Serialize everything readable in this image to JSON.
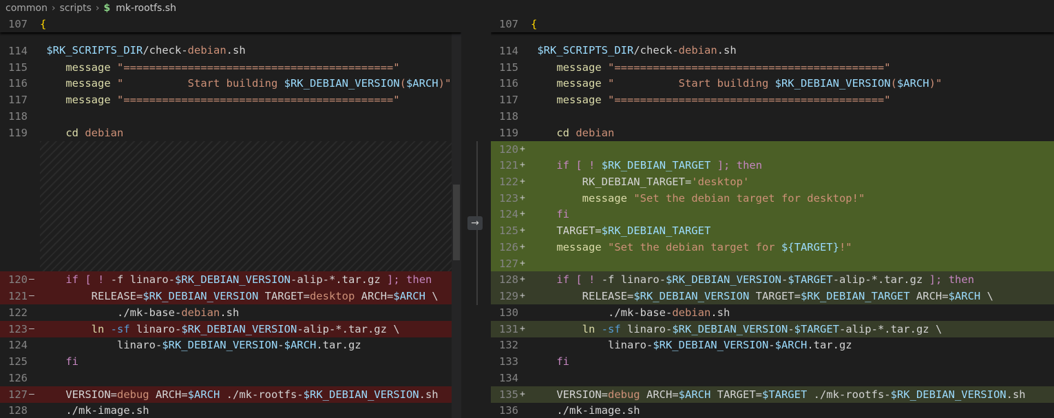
{
  "breadcrumb": {
    "parts": [
      "common",
      "scripts"
    ],
    "dollar": "$",
    "file": "mk-rootfs.sh"
  },
  "left": {
    "sticky_num": "107",
    "sticky_code": "{",
    "partial_code": " $RK_SCRIPTS_DIR/check-debian.sh",
    "lines": [
      {
        "num": "114",
        "mark": "",
        "code": ""
      },
      {
        "num": "115",
        "mark": "",
        "code": "    message \"==========================================\""
      },
      {
        "num": "116",
        "mark": "",
        "code": "    message \"          Start building $RK_DEBIAN_VERSION($ARCH)\""
      },
      {
        "num": "117",
        "mark": "",
        "code": "    message \"==========================================\""
      },
      {
        "num": "118",
        "mark": "",
        "code": ""
      },
      {
        "num": "119",
        "mark": "",
        "code": "    cd debian"
      },
      {
        "num": "120",
        "mark": "—",
        "code": "    if [ ! -f linaro-$RK_DEBIAN_VERSION-alip-*.tar.gz ]; then"
      },
      {
        "num": "121",
        "mark": "—",
        "code": "        RELEASE=$RK_DEBIAN_VERSION TARGET=desktop ARCH=$ARCH \\"
      },
      {
        "num": "122",
        "mark": "",
        "code": "            ./mk-base-debian.sh"
      },
      {
        "num": "123",
        "mark": "—",
        "code": "        ln -sf linaro-$RK_DEBIAN_VERSION-alip-*.tar.gz \\"
      },
      {
        "num": "124",
        "mark": "",
        "code": "            linaro-$RK_DEBIAN_VERSION-$ARCH.tar.gz"
      },
      {
        "num": "125",
        "mark": "",
        "code": "    fi"
      },
      {
        "num": "126",
        "mark": "",
        "code": ""
      },
      {
        "num": "127",
        "mark": "—",
        "code": "    VERSION=debug ARCH=$ARCH ./mk-rootfs-$RK_DEBIAN_VERSION.sh"
      },
      {
        "num": "128",
        "mark": "",
        "code": "    ./mk-image.sh"
      }
    ]
  },
  "right": {
    "sticky_num": "107",
    "sticky_code": "{",
    "partial_code": " $RK_SCRIPTS_DIR/check-debian.sh",
    "lines": [
      {
        "num": "114",
        "mark": "",
        "code": ""
      },
      {
        "num": "115",
        "mark": "",
        "code": "    message \"==========================================\""
      },
      {
        "num": "116",
        "mark": "",
        "code": "    message \"          Start building $RK_DEBIAN_VERSION($ARCH)\""
      },
      {
        "num": "117",
        "mark": "",
        "code": "    message \"==========================================\""
      },
      {
        "num": "118",
        "mark": "",
        "code": ""
      },
      {
        "num": "119",
        "mark": "",
        "code": "    cd debian"
      },
      {
        "num": "120",
        "mark": "+",
        "code": ""
      },
      {
        "num": "121",
        "mark": "+",
        "code": "    if [ ! $RK_DEBIAN_TARGET ]; then"
      },
      {
        "num": "122",
        "mark": "+",
        "code": "        RK_DEBIAN_TARGET='desktop'"
      },
      {
        "num": "123",
        "mark": "+",
        "code": "        message \"Set the debian target for desktop!\""
      },
      {
        "num": "124",
        "mark": "+",
        "code": "    fi"
      },
      {
        "num": "125",
        "mark": "+",
        "code": "    TARGET=$RK_DEBIAN_TARGET"
      },
      {
        "num": "126",
        "mark": "+",
        "code": "    message \"Set the debian target for ${TARGET}!\""
      },
      {
        "num": "127",
        "mark": "+",
        "code": ""
      },
      {
        "num": "128",
        "mark": "+",
        "code": "    if [ ! -f linaro-$RK_DEBIAN_VERSION-$TARGET-alip-*.tar.gz ]; then"
      },
      {
        "num": "129",
        "mark": "+",
        "code": "        RELEASE=$RK_DEBIAN_VERSION TARGET=$RK_DEBIAN_TARGET ARCH=$ARCH \\"
      },
      {
        "num": "130",
        "mark": "",
        "code": "            ./mk-base-debian.sh"
      },
      {
        "num": "131",
        "mark": "+",
        "code": "        ln -sf linaro-$RK_DEBIAN_VERSION-$TARGET-alip-*.tar.gz \\"
      },
      {
        "num": "132",
        "mark": "",
        "code": "            linaro-$RK_DEBIAN_VERSION-$ARCH.tar.gz"
      },
      {
        "num": "133",
        "mark": "",
        "code": "    fi"
      },
      {
        "num": "134",
        "mark": "",
        "code": ""
      },
      {
        "num": "135",
        "mark": "+",
        "code": "    VERSION=debug ARCH=$ARCH TARGET=$TARGET ./mk-rootfs-$RK_DEBIAN_VERSION.sh"
      },
      {
        "num": "136",
        "mark": "",
        "code": "    ./mk-image.sh"
      }
    ]
  },
  "colors": {
    "removed_line": "#4b1818",
    "removed_text": "#8f2a2a",
    "added_line": "#373d29",
    "added_text": "#4b5f26"
  },
  "icons": {
    "arrow": "→",
    "revert": "arrow-right-icon"
  }
}
